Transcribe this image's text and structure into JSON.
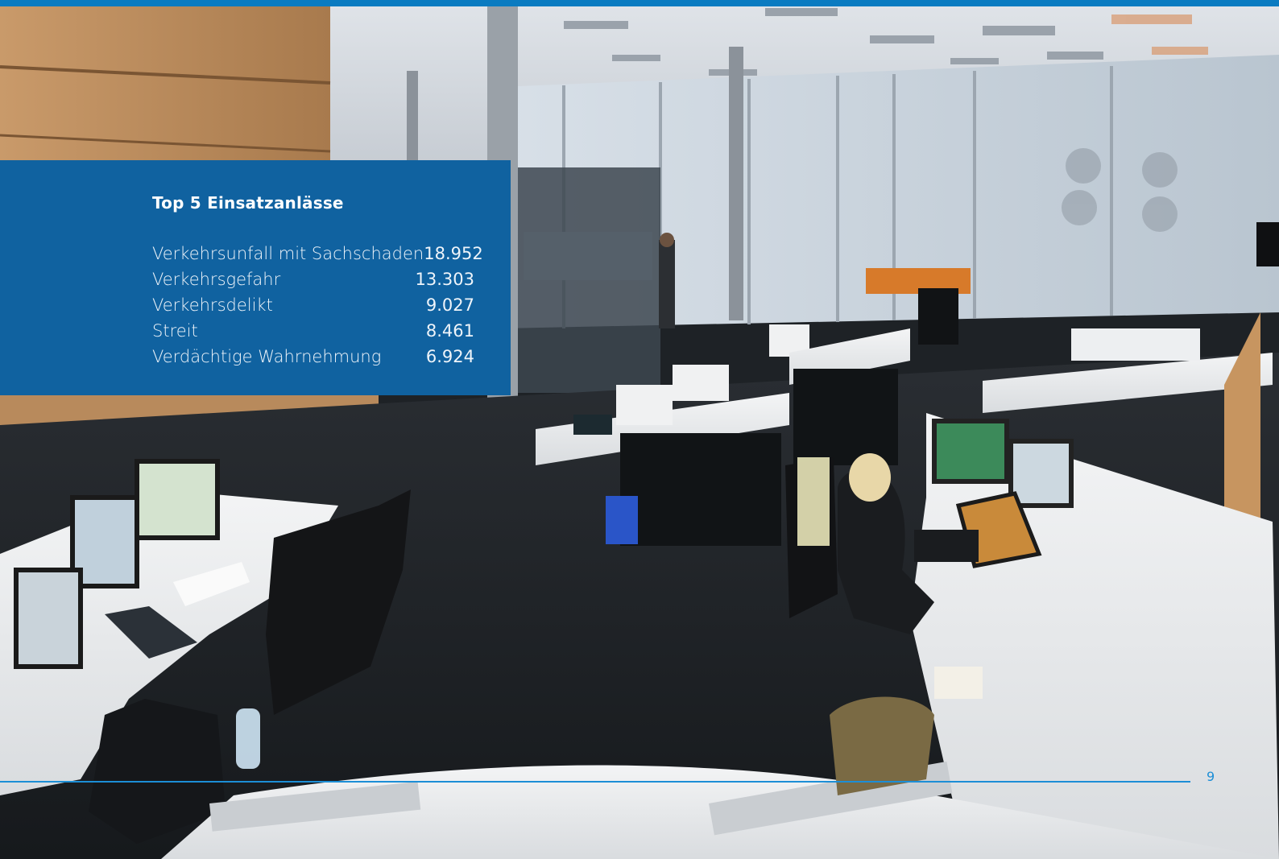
{
  "panel": {
    "title": "Top 5 Einsatzanlässe",
    "items": [
      {
        "label": "Verkehrsunfall mit Sachschaden",
        "value": "18.952"
      },
      {
        "label": "Verkehrsgefahr",
        "value": "13.303"
      },
      {
        "label": "Verkehrsdelikt",
        "value": "9.027"
      },
      {
        "label": "Streit",
        "value": "8.461"
      },
      {
        "label": "Verdächtige Wahrnehmung",
        "value": "6.924"
      }
    ]
  },
  "page_number": "9",
  "colors": {
    "accent_bar": "#0a7bc1",
    "panel": "#1062a0",
    "rule": "#1c8ed6"
  },
  "image": {
    "subject": "control-room-photo"
  }
}
